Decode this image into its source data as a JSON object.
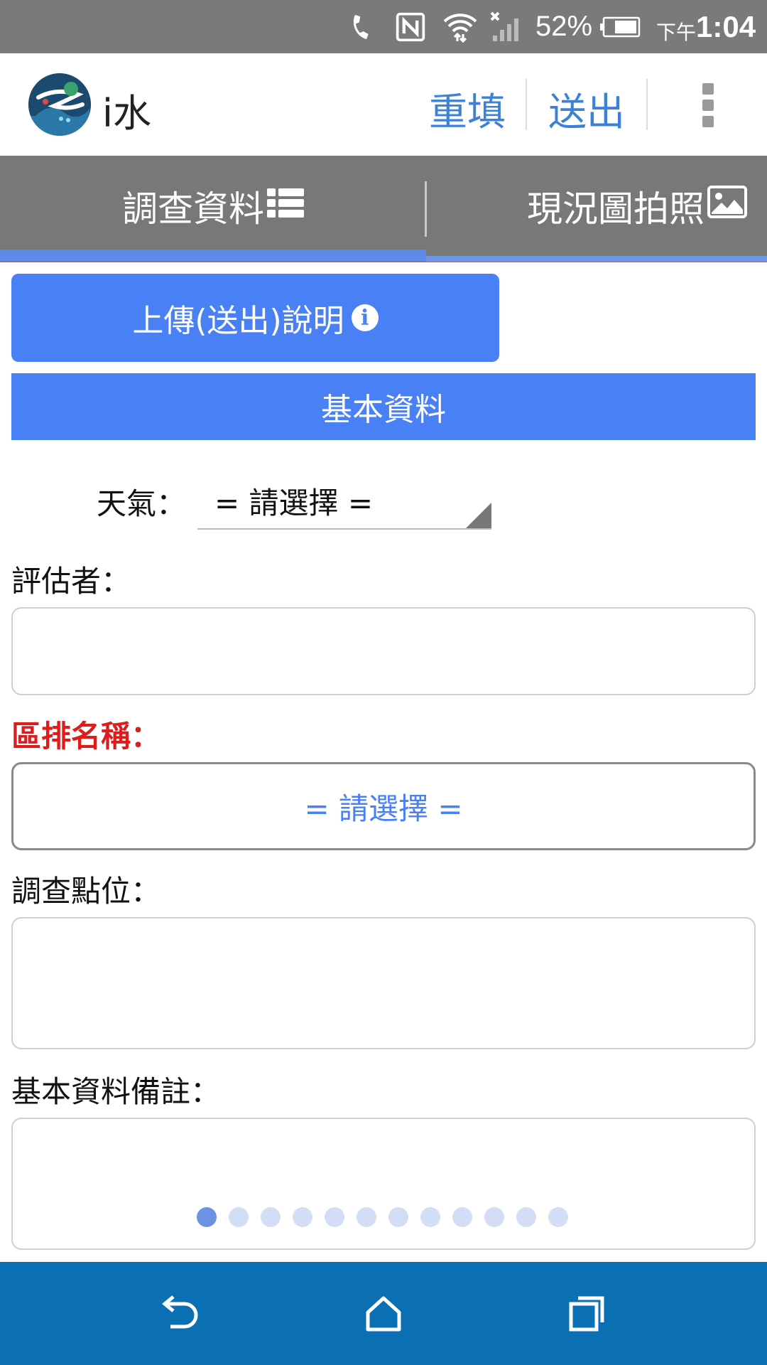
{
  "status_bar": {
    "battery_percent": "52%",
    "period": "下午",
    "time": "1:04",
    "icons": [
      "phone-icon",
      "nfc-icon",
      "wifi-icon",
      "signal-icon",
      "battery-icon"
    ]
  },
  "app_bar": {
    "app_name": "i水",
    "reset_label": "重填",
    "submit_label": "送出",
    "menu_icon": "more-vert-icon"
  },
  "tabs": [
    {
      "label": "調查資料",
      "icon": "list-icon",
      "active": true
    },
    {
      "label": "現況圖拍照",
      "icon": "image-icon",
      "active": false
    }
  ],
  "upload_button": {
    "label": "上傳(送出)說明",
    "icon": "info-icon"
  },
  "section": {
    "title": "基本資料"
  },
  "form": {
    "weather": {
      "label": "天氣：",
      "value": "= 請選擇 ="
    },
    "assessor": {
      "label": "評估者：",
      "value": ""
    },
    "district": {
      "label": "區排名稱：",
      "value": "= 請選擇 ="
    },
    "survey_point": {
      "label": "調查點位：",
      "value": ""
    },
    "remarks": {
      "label": "基本資料備註：",
      "value": ""
    }
  },
  "pager": {
    "total": 12,
    "current": 1
  },
  "nav_bar": {
    "icons": [
      "back-icon",
      "home-icon",
      "recents-icon"
    ]
  },
  "colors": {
    "accent": "#4a80f5",
    "statusbar": "#7a7a7a",
    "tabbar": "#787878",
    "navbar": "#0a6fb3",
    "required": "#e01b1b"
  }
}
